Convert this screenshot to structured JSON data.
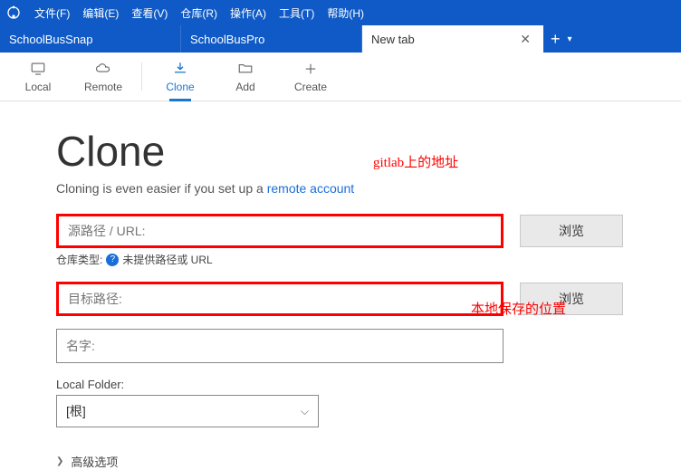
{
  "menu": {
    "items": [
      "文件(F)",
      "编辑(E)",
      "查看(V)",
      "仓库(R)",
      "操作(A)",
      "工具(T)",
      "帮助(H)"
    ]
  },
  "tabs": {
    "items": [
      {
        "label": "SchoolBusSnap",
        "active": false
      },
      {
        "label": "SchoolBusPro",
        "active": false
      },
      {
        "label": "New tab",
        "active": true
      }
    ]
  },
  "toolbar": {
    "local": "Local",
    "remote": "Remote",
    "clone": "Clone",
    "add": "Add",
    "create": "Create"
  },
  "clone": {
    "title": "Clone",
    "subtitle_pre": "Cloning is even easier if you set up a ",
    "subtitle_link": "remote account",
    "source_placeholder": "源路径 / URL:",
    "browse": "浏览",
    "repo_type_label": "仓库类型:",
    "repo_type_value": "未提供路径或 URL",
    "dest_placeholder": "目标路径:",
    "name_placeholder": "名字:",
    "local_folder_label": "Local Folder:",
    "local_folder_value": "[根]",
    "advanced": "高级选项"
  },
  "annotations": {
    "gitlab": "gitlab上的地址",
    "local_save": "本地保存的位置"
  }
}
